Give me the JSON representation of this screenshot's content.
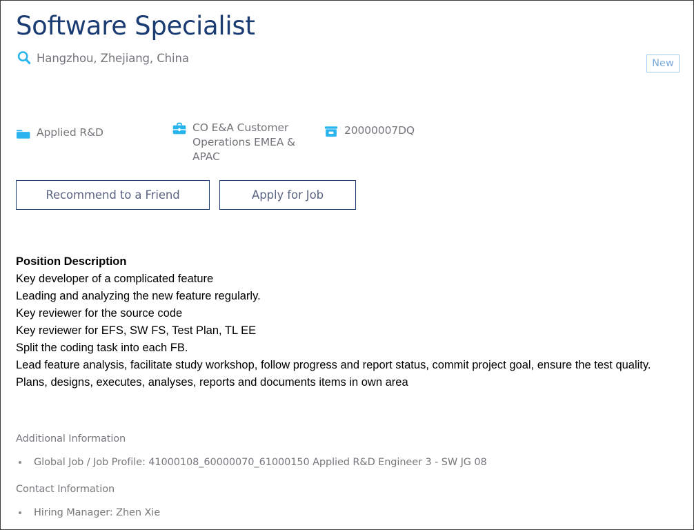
{
  "header": {
    "title": "Software Specialist",
    "location": "Hangzhou, Zhejiang, China",
    "location_icon": "search-icon",
    "badge": "New"
  },
  "meta": [
    {
      "icon": "folder-icon",
      "label": "Applied R&D"
    },
    {
      "icon": "briefcase-icon",
      "label": "CO E&A Customer Operations EMEA & APAC"
    },
    {
      "icon": "archive-box-icon",
      "label": "20000007DQ"
    }
  ],
  "actions": {
    "recommend_label": "Recommend to a Friend",
    "apply_label": "Apply for Job"
  },
  "description": {
    "heading": "Position Description",
    "lines": [
      "Key developer of a complicated feature",
      "Leading and analyzing the new feature regularly.",
      "Key reviewer for the source code",
      "Key reviewer for EFS, SW FS, Test Plan, TL EE",
      "Split the coding task into each FB.",
      "Lead feature analysis, facilitate study workshop, follow progress and report status, commit project goal, ensure the test quality.",
      "Plans, designs, executes, analyses, reports and documents items in own area"
    ]
  },
  "sections": [
    {
      "heading": "Additional Information",
      "items": [
        "Global Job / Job Profile: 41000108_60000070_61000150 Applied R&D Engineer 3 - SW JG 08"
      ]
    },
    {
      "heading": "Contact Information",
      "items": [
        "Hiring Manager: Zhen Xie"
      ]
    }
  ],
  "colors": {
    "title": "#1b3b73",
    "accent_cyan": "#29b4ed",
    "muted_text": "#76787c",
    "badge_border": "#9dc8ef",
    "badge_text": "#7aa9db",
    "button_border": "#1b3b73"
  }
}
